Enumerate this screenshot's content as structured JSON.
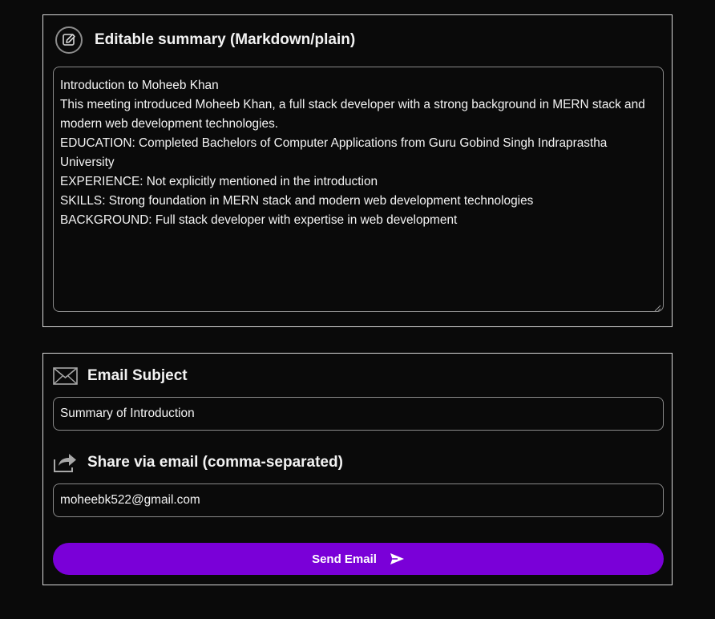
{
  "summary_section": {
    "title": "Editable summary (Markdown/plain)",
    "icon": "edit-icon",
    "lines": [
      "Introduction to Moheeb Khan",
      "This meeting introduced Moheeb Khan, a full stack developer with a strong background in MERN stack and modern web development technologies.",
      "EDUCATION: Completed Bachelors of Computer Applications from Guru Gobind Singh Indraprastha University",
      "EXPERIENCE: Not explicitly mentioned in the introduction",
      "SKILLS: Strong foundation in MERN stack and modern web development technologies",
      "BACKGROUND: Full stack developer with expertise in web development"
    ]
  },
  "email_section": {
    "subject_label": "Email Subject",
    "subject_icon": "mail-icon",
    "subject_value": "Summary of Introduction",
    "share_label": "Share via email (comma-separated)",
    "share_icon": "share-icon",
    "recipients_value": "moheebk522@gmail.com",
    "send_label": "Send Email",
    "send_icon": "send-icon"
  },
  "colors": {
    "background": "#0a0a0a",
    "accent": "#7a00d8",
    "border": "#d9d9d9"
  }
}
